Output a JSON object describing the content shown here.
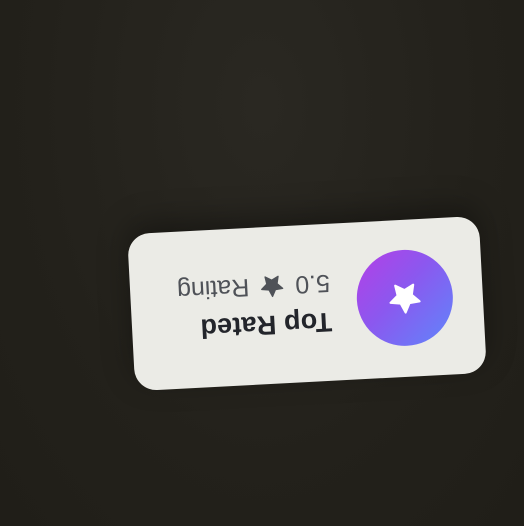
{
  "card": {
    "title": "Top Rated",
    "rating_value": "5.0",
    "rating_label": "Rating",
    "badge_icon": "star-icon",
    "inline_icon": "star-icon",
    "colors": {
      "background": "#25231c",
      "card": "#ebebe6",
      "title_text": "#23252b",
      "meta_text": "#4f5258",
      "badge_gradient_start": "#5f86fb",
      "badge_gradient_mid": "#8b58ef",
      "badge_gradient_end": "#b43fe6"
    }
  }
}
